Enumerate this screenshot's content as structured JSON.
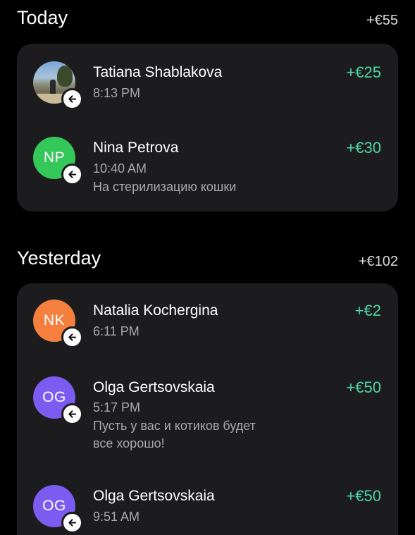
{
  "colors": {
    "background": "#000000",
    "card": "#1c1c1e",
    "amount_green": "#4fd6a3",
    "secondary_text": "#a8a8ad"
  },
  "sections": [
    {
      "title": "Today",
      "total": "+€55",
      "transactions": [
        {
          "name": "Tatiana Shablakova",
          "time": "8:13 PM",
          "amount": "+€25",
          "avatar": {
            "type": "photo"
          },
          "badge_icon": "arrow-left-icon"
        },
        {
          "name": "Nina Petrova",
          "time": "10:40 AM",
          "note": "На стерилизацию кошки",
          "amount": "+€30",
          "avatar": {
            "type": "initials",
            "initials": "NP",
            "color": "#34c759"
          },
          "badge_icon": "arrow-left-icon"
        }
      ]
    },
    {
      "title": "Yesterday",
      "total": "+€102",
      "transactions": [
        {
          "name": "Natalia Kochergina",
          "time": "6:11 PM",
          "amount": "+€2",
          "avatar": {
            "type": "initials",
            "initials": "NK",
            "color": "#f5803e"
          },
          "badge_icon": "arrow-left-icon"
        },
        {
          "name": "Olga Gertsovskaia",
          "time": "5:17 PM",
          "note_line1": "Пусть у вас и котиков будет",
          "note_line2": "все хорошо!",
          "amount": "+€50",
          "avatar": {
            "type": "initials",
            "initials": "OG",
            "color": "#7b5cf0"
          },
          "badge_icon": "arrow-left-icon"
        },
        {
          "name": "Olga Gertsovskaia",
          "time": "9:51 AM",
          "amount": "+€50",
          "avatar": {
            "type": "initials",
            "initials": "OG",
            "color": "#7b5cf0"
          },
          "badge_icon": "arrow-left-icon"
        }
      ]
    }
  ]
}
